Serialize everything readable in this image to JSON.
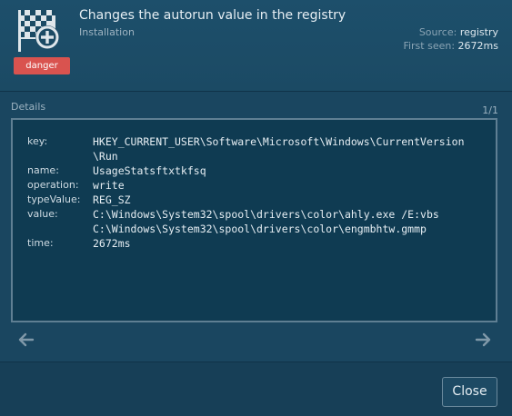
{
  "header": {
    "title": "Changes the autorun value in the registry",
    "subtitle": "Installation",
    "badge": "danger",
    "icon": "checkered-flag-plus-icon",
    "source_label": "Source:",
    "source_value": "registry",
    "first_seen_label": "First seen:",
    "first_seen_value": "2672ms"
  },
  "details": {
    "label": "Details",
    "pager": "1/1",
    "rows": [
      {
        "key": "key:",
        "value": [
          "HKEY_CURRENT_USER\\Software\\Microsoft\\Windows\\CurrentVersion",
          "\\Run"
        ]
      },
      {
        "key": "name:",
        "value": [
          "UsageStatsftxtkfsq"
        ]
      },
      {
        "key": "operation:",
        "value": [
          "write"
        ]
      },
      {
        "key": "typeValue:",
        "value": [
          "REG_SZ"
        ]
      },
      {
        "key": "value:",
        "value": [
          "C:\\Windows\\System32\\spool\\drivers\\color\\ahly.exe /E:vbs",
          "C:\\Windows\\System32\\spool\\drivers\\color\\engmbhtw.gmmp"
        ]
      },
      {
        "key": "time:",
        "value": [
          "2672ms"
        ]
      }
    ]
  },
  "footer": {
    "close_label": "Close"
  },
  "colors": {
    "danger": "#d9534f",
    "background": "#1a4660",
    "details_bg": "#0f3b52"
  }
}
